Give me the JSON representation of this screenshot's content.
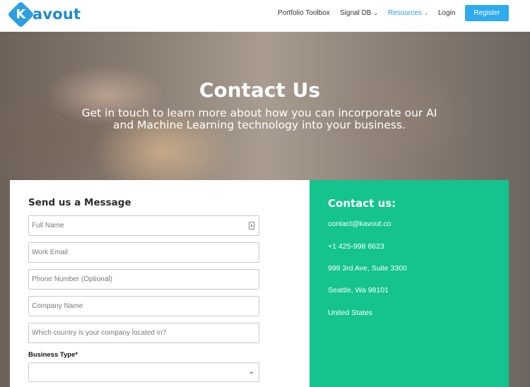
{
  "header": {
    "logo_letter": "K",
    "logo_text": "avout",
    "nav": [
      {
        "label": "Portfolio Toolbox"
      },
      {
        "label": "Signal DB"
      },
      {
        "label": "Resources"
      },
      {
        "label": "Login"
      }
    ],
    "register_label": "Register",
    "colors": {
      "brand": "#2b9fe0",
      "register_bg": "#2eaaf0"
    }
  },
  "hero": {
    "title": "Contact Us",
    "subtitle_line1": "Get in touch to learn more about how you can incorporate our AI",
    "subtitle_line2": "and Machine Learning technology into your business."
  },
  "form": {
    "title": "Send us a Message",
    "fields": [
      {
        "placeholder": "Full Name"
      },
      {
        "placeholder": "Work Email"
      },
      {
        "placeholder": "Phone Number (Optional)"
      },
      {
        "placeholder": "Company Name"
      },
      {
        "placeholder": "Which country is your company located in?"
      }
    ],
    "business_type_label": "Business Type*",
    "business_type_value": ""
  },
  "contact": {
    "title": "Contact us:",
    "email": "contact@kavout.co",
    "phone": "+1 425-998 8623",
    "address1": "999 3rd Ave, Suite 3300",
    "address2": "Seattle, Wa 98101",
    "country": "United States",
    "panel_color": "#14c38d"
  }
}
